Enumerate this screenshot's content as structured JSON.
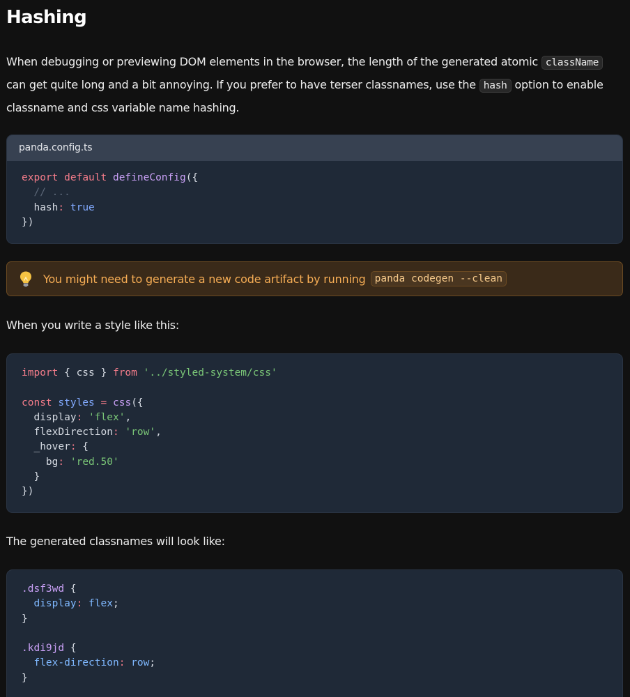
{
  "heading": "Hashing",
  "intro": {
    "line1_text": "When debugging or previewing DOM elements in the browser, the length of the generated atomic",
    "line1_code": "className",
    "line2_text_before": "can get quite long and a bit annoying. If you prefer to have terser classnames, use the",
    "line2_code": "hash",
    "line2_text_after": "option to enable",
    "line3_text": "classname and css variable name hashing."
  },
  "config_block": {
    "filename": "panda.config.ts",
    "lines": {
      "l1_kw1": "export",
      "l1_kw2": "default",
      "l1_fn": "defineConfig",
      "l1_punct": "({",
      "l2_comment": "  // ...",
      "l3_key": "  hash",
      "l3_colon": ":",
      "l3_value": "true",
      "l4_close": "})"
    }
  },
  "callout": {
    "icon": "lightbulb-icon",
    "text": "You might need to generate a new code artifact by running",
    "code": "panda codegen --clean"
  },
  "style_intro": "When you write a style like this:",
  "style_block": {
    "l1_kw": "import",
    "l1_mid": " { css } ",
    "l1_kw2": "from",
    "l1_str": "'../styled-system/css'",
    "l3_kw": "const",
    "l3_var": "styles",
    "l3_eq": "=",
    "l3_fn": "css",
    "l3_punct": "({",
    "l4_key": "  display",
    "l4_val": "'flex'",
    "l5_key": "  flexDirection",
    "l5_val": "'row'",
    "l6_key": "  _hover",
    "l6_punct": " {",
    "l7_key": "    bg",
    "l7_val": "'red.50'",
    "l8_close": "  }",
    "l9_close": "})"
  },
  "generated_intro": "The generated classnames will look like:",
  "css_block": {
    "r1_selector": ".dsf3wd",
    "r1_prop": "display",
    "r1_value": "flex",
    "r2_selector": ".kdi9jd",
    "r2_prop": "flex-direction",
    "r2_value": "row"
  }
}
